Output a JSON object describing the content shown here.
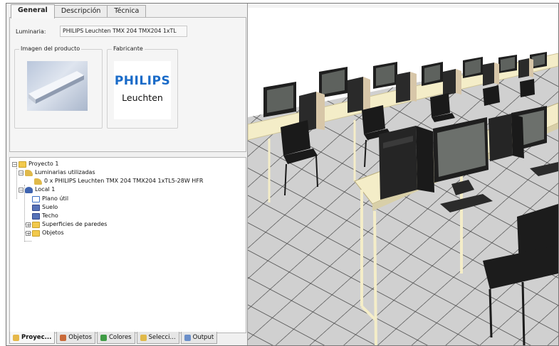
{
  "tabs": {
    "general": "General",
    "descripcion": "Descripción",
    "tecnica": "Técnica"
  },
  "luminaria": {
    "label": "Luminaria:",
    "value": "PHILIPS Leuchten TMX 204 TMX204 1xTL"
  },
  "groups": {
    "imagen": "Imagen del producto",
    "fabricante": "Fabricante"
  },
  "logo": {
    "brand": "PHILIPS",
    "sub": "Leuchten",
    "brand_color": "#1a6bc8"
  },
  "tree": {
    "proyecto": "Proyecto 1",
    "luminarias": "Luminarias utilizadas",
    "luminaria_item": "0 x PHILIPS Leuchten TMX 204 TMX204 1xTL5-28W HFR",
    "local": "Local 1",
    "plano": "Plano útil",
    "suelo": "Suelo",
    "techo": "Techo",
    "superficies": "Superficies de paredes",
    "objetos": "Objetos"
  },
  "bottom_tabs": {
    "proyecto": "Proyec...",
    "objetos": "Objetos",
    "colores": "Colores",
    "seleccion": "Selecci...",
    "output": "Output"
  },
  "icons": [
    "folder-icon",
    "luminaires-icon",
    "luminaire-icon",
    "room-icon",
    "plane-icon",
    "surface-icon",
    "project-tab-icon",
    "objects-tab-icon",
    "colors-tab-icon",
    "selection-tab-icon",
    "output-tab-icon"
  ],
  "colors": {
    "table_frame": "#f4edc8",
    "floor": "#cfcfcf",
    "monitor_screen": "#6c706c",
    "dark_furniture": "#1e1e1e"
  }
}
